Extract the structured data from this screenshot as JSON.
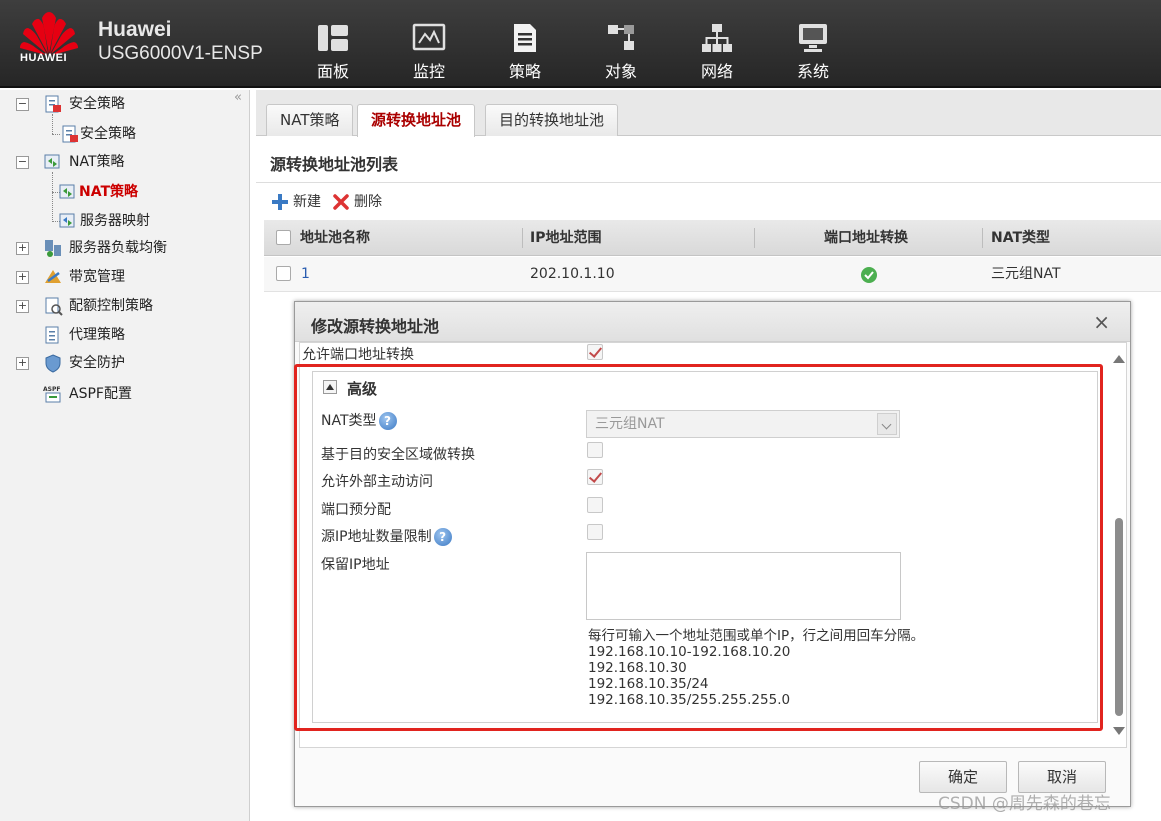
{
  "header": {
    "logo_text": "HUAWEI",
    "brand": "Huawei",
    "model": "USG6000V1-ENSP",
    "nav": [
      {
        "label": "面板",
        "icon": "dashboard-icon"
      },
      {
        "label": "监控",
        "icon": "monitor-icon"
      },
      {
        "label": "策略",
        "icon": "policy-icon"
      },
      {
        "label": "对象",
        "icon": "object-icon"
      },
      {
        "label": "网络",
        "icon": "network-icon"
      },
      {
        "label": "系统",
        "icon": "system-icon"
      }
    ]
  },
  "sidebar": {
    "collapse_glyph": "«",
    "items": [
      {
        "label": "安全策略",
        "toggle": "−"
      },
      {
        "label": "安全策略"
      },
      {
        "label": "NAT策略",
        "toggle": "−"
      },
      {
        "label": "NAT策略",
        "active": true
      },
      {
        "label": "服务器映射"
      },
      {
        "label": "服务器负载均衡",
        "toggle": "+"
      },
      {
        "label": "带宽管理",
        "toggle": "+"
      },
      {
        "label": "配额控制策略",
        "toggle": "+"
      },
      {
        "label": "代理策略"
      },
      {
        "label": "安全防护",
        "toggle": "+"
      },
      {
        "label": "ASPF配置"
      }
    ]
  },
  "tabs": [
    {
      "label": "NAT策略"
    },
    {
      "label": "源转换地址池",
      "active": true
    },
    {
      "label": "目的转换地址池"
    }
  ],
  "list": {
    "title": "源转换地址池列表",
    "toolbar": {
      "new_label": "新建",
      "delete_label": "删除"
    },
    "columns": [
      "地址池名称",
      "IP地址范围",
      "端口地址转换",
      "NAT类型"
    ],
    "rows": [
      {
        "name": "1",
        "ip_range": "202.10.1.10",
        "port_translation": true,
        "nat_type": "三元组NAT"
      }
    ]
  },
  "dialog": {
    "title": "修改源转换地址池",
    "close_glyph": "×",
    "allow_port_translation_label": "允许端口地址转换",
    "advanced": {
      "title": "高级",
      "nat_type_label": "NAT类型",
      "nat_type_value": "三元组NAT",
      "dest_zone_label": "基于目的安全区域做转换",
      "allow_external_label": "允许外部主动访问",
      "port_prealloc_label": "端口预分配",
      "src_ip_limit_label": "源IP地址数量限制",
      "reserved_ip_label": "保留IP地址",
      "reserved_ip_value": "",
      "hint_lines": [
        "每行可输入一个地址范围或单个IP，行之间用回车分隔。",
        "192.168.10.10-192.168.10.20",
        "192.168.10.30",
        "192.168.10.35/24",
        "192.168.10.35/255.255.255.0"
      ]
    },
    "ok_label": "确定",
    "cancel_label": "取消"
  },
  "watermark": "CSDN @周先森的巷忘",
  "colors": {
    "accent": "#a00000",
    "highlight": "#e1241f",
    "header_bg": "#2f2f2f"
  }
}
